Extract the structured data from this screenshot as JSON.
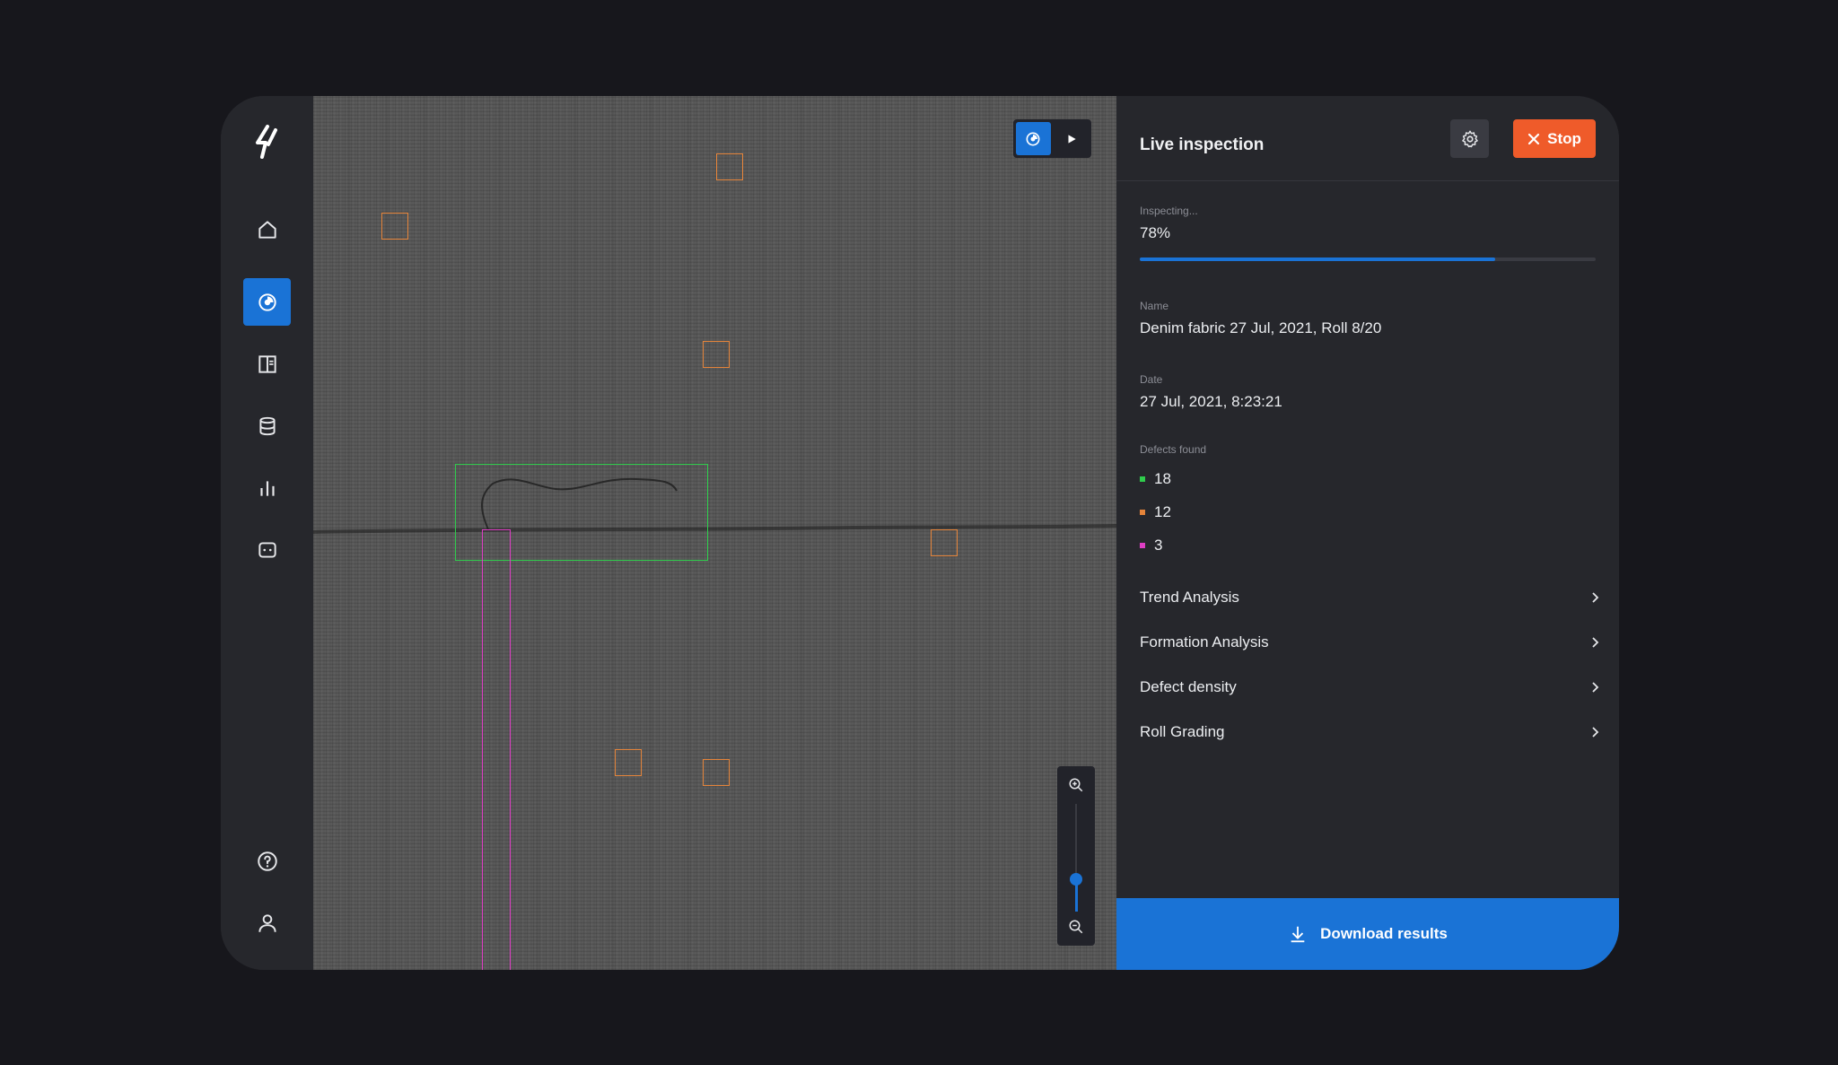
{
  "nav": {
    "logo": "bolt-logo",
    "items": [
      {
        "icon": "home-icon",
        "active": false
      },
      {
        "icon": "live-inspection-icon",
        "active": true
      },
      {
        "icon": "layout-icon",
        "active": false
      },
      {
        "icon": "database-icon",
        "active": false
      },
      {
        "icon": "bar-chart-icon",
        "active": false
      },
      {
        "icon": "chat-icon",
        "active": false
      }
    ],
    "bottom_items": [
      {
        "icon": "help-icon"
      },
      {
        "icon": "user-icon"
      }
    ]
  },
  "viewer": {
    "mode_toggle": [
      {
        "icon": "live-icon",
        "active": true
      },
      {
        "icon": "play-icon",
        "active": false
      }
    ],
    "zoom_level": 0.3,
    "colors": {
      "orange": "#e5843a",
      "green": "#2fcc4c",
      "magenta": "#de3ec4"
    }
  },
  "panel": {
    "title": "Live inspection",
    "stop_label": "Stop",
    "progress": {
      "label": "Inspecting...",
      "value_text": "78%",
      "value": 78
    },
    "name": {
      "label": "Name",
      "value": "Denim fabric 27 Jul, 2021, Roll 8/20"
    },
    "date": {
      "label": "Date",
      "value": "27 Jul, 2021, 8:23:21"
    },
    "defects": {
      "label": "Defects found",
      "items": [
        {
          "color": "#2fcc4c",
          "count": "18"
        },
        {
          "color": "#e5843a",
          "count": "12"
        },
        {
          "color": "#de3ec4",
          "count": "3"
        }
      ]
    },
    "links": [
      {
        "label": "Trend Analysis"
      },
      {
        "label": "Formation Analysis"
      },
      {
        "label": "Defect density"
      },
      {
        "label": "Roll Grading"
      }
    ],
    "download_label": "Download results"
  }
}
